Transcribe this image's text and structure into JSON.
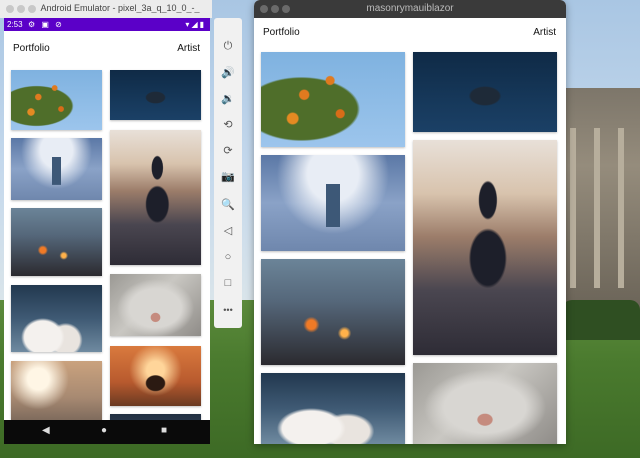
{
  "emulator": {
    "window_title": "Android Emulator - pixel_3a_q_10_0_-_",
    "status_bar": {
      "time": "2:53",
      "icons": "⚙ ▣ ⊘",
      "right_icons": "▾◢▮"
    },
    "app": {
      "title": "Portfolio",
      "artist": "Artist"
    },
    "toolbar": {
      "close": "×",
      "minimize": "–",
      "buttons": [
        {
          "name": "power-icon",
          "glyph": "⏻"
        },
        {
          "name": "volume-up-icon",
          "glyph": "🔊"
        },
        {
          "name": "volume-down-icon",
          "glyph": "🔉"
        },
        {
          "name": "rotate-left-icon",
          "glyph": "⟲"
        },
        {
          "name": "rotate-right-icon",
          "glyph": "⟳"
        },
        {
          "name": "camera-icon",
          "glyph": "📷"
        },
        {
          "name": "zoom-icon",
          "glyph": "🔍"
        },
        {
          "name": "back-icon",
          "glyph": "◁"
        },
        {
          "name": "home-icon",
          "glyph": "○"
        },
        {
          "name": "overview-icon",
          "glyph": "□"
        },
        {
          "name": "more-icon",
          "glyph": "•••"
        }
      ]
    },
    "navbar": {
      "back": "◀",
      "home": "●",
      "recents": "■"
    },
    "photos": [
      "orange-tree",
      "swimmer",
      "tower",
      "silhouette",
      "rain-window",
      "clouds",
      "cat-nose",
      "sunset-person",
      "bright-sun",
      "dark"
    ]
  },
  "mac_window": {
    "title": "masonrymauiblazor",
    "app": {
      "title": "Portfolio",
      "artist": "Artist"
    },
    "photos": [
      "orange-tree",
      "swimmer",
      "tower",
      "silhouette",
      "rain-window",
      "cat-nose",
      "clouds"
    ]
  },
  "colors": {
    "status_bar": "#5b00c8",
    "mac_titlebar": "#3a3a3a"
  }
}
